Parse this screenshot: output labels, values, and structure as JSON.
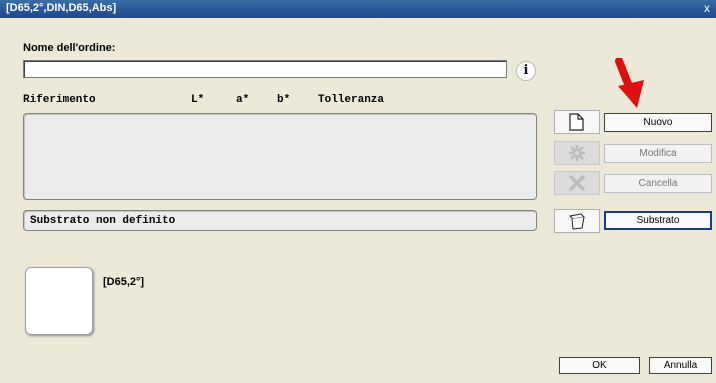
{
  "window": {
    "title": "[D65,2°,DIN,D65,Abs]",
    "close_label": "x"
  },
  "form": {
    "order_name_label": "Nome dell'ordine:",
    "order_name_value": "",
    "info_label": "i"
  },
  "table": {
    "headers": {
      "reference": "Riferimento",
      "l": "L*",
      "a": "a*",
      "b": "b*",
      "tolerance": "Tolleranza"
    },
    "rows": []
  },
  "substrate": {
    "value": "Substrato non definito"
  },
  "swatch": {
    "label": "[D65,2°]"
  },
  "buttons": {
    "new": "Nuovo",
    "edit": "Modifica",
    "delete": "Cancella",
    "substrate": "Substrato",
    "ok": "OK",
    "cancel": "Annulla"
  },
  "icons": {
    "new": "document-icon",
    "edit": "gear-icon",
    "delete": "cross-icon",
    "substrate": "substrate-stack-icon",
    "info": "info-icon",
    "annotation": "red-arrow-icon"
  },
  "colors": {
    "titlebar": "#2b579a",
    "arrow": "#e01010",
    "window_bg": "#ece9d8"
  }
}
